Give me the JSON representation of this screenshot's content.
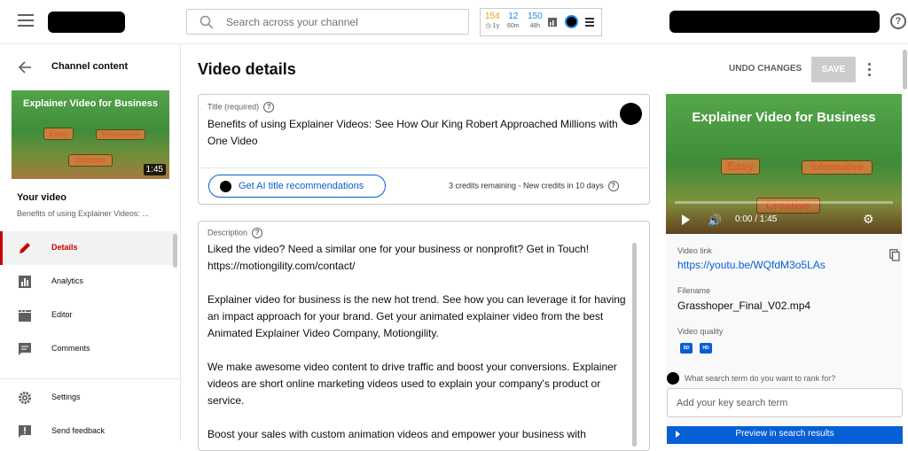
{
  "header": {
    "search_placeholder": "Search across your channel",
    "stats": [
      {
        "value": "154",
        "period": "1y",
        "color": "#e8a800"
      },
      {
        "value": "12",
        "period": "60m",
        "color": "#1e88e5"
      },
      {
        "value": "150",
        "period": "48h",
        "color": "#1e88e5"
      }
    ],
    "help_label": "?"
  },
  "sidebar": {
    "title": "Channel content",
    "thumbnail": {
      "title": "Explainer Video for Business",
      "sign_1": "Easy",
      "sign_2": "Informative",
      "sign_3": "Creative",
      "duration": "1:45"
    },
    "your_video_label": "Your video",
    "video_subtitle": "Benefits of using Explainer Videos: ...",
    "items": [
      {
        "label": "Details",
        "active": true,
        "icon": "pencil-icon"
      },
      {
        "label": "Analytics",
        "active": false,
        "icon": "analytics-icon"
      },
      {
        "label": "Editor",
        "active": false,
        "icon": "clapper-icon"
      },
      {
        "label": "Comments",
        "active": false,
        "icon": "comment-icon"
      },
      {
        "label": "Settings",
        "active": false,
        "icon": "gear-icon"
      },
      {
        "label": "Send feedback",
        "active": false,
        "icon": "feedback-icon"
      }
    ]
  },
  "main": {
    "page_title": "Video details",
    "undo_label": "UNDO CHANGES",
    "save_label": "SAVE",
    "title_field": {
      "label": "Title (required)",
      "value": "Benefits of using Explainer Videos: See How Our King Robert Approached Millions with One Video"
    },
    "ai": {
      "button_label": "Get AI title recommendations",
      "credits": "3 credits remaining - New credits in 10 days"
    },
    "description_field": {
      "label": "Description",
      "value": "Liked the video? Need a similar one for your business or nonprofit? Get in Touch!\nhttps://motiongility.com/contact/\n\nExplainer video for business is the new hot trend. See how you can leverage it for having an impact approach for your brand. Get your animated explainer video from the best Animated Explainer Video Company, Motiongility.\n\nWe make awesome video content to drive traffic and boost your conversions. Explainer videos are short online marketing videos used to explain your company's product or service.\n\nBoost your sales with custom animation videos and empower your business with"
    }
  },
  "right_panel": {
    "player": {
      "title": "Explainer Video for Business",
      "sign_1": "Easy",
      "sign_2": "Informative",
      "sign_3": "Creative",
      "time": "0:00 / 1:45"
    },
    "video_link_label": "Video link",
    "video_link": "https://youtu.be/WQfdM3o5LAs",
    "filename_label": "Filename",
    "filename": "Grasshoper_Final_V02.mp4",
    "quality_label": "Video quality",
    "quality_badges": [
      "SD",
      "HD"
    ],
    "keyword_label": "What search term do you want to rank for?",
    "keyword_placeholder": "Add your key search term",
    "preview_label": "Preview in search results"
  }
}
